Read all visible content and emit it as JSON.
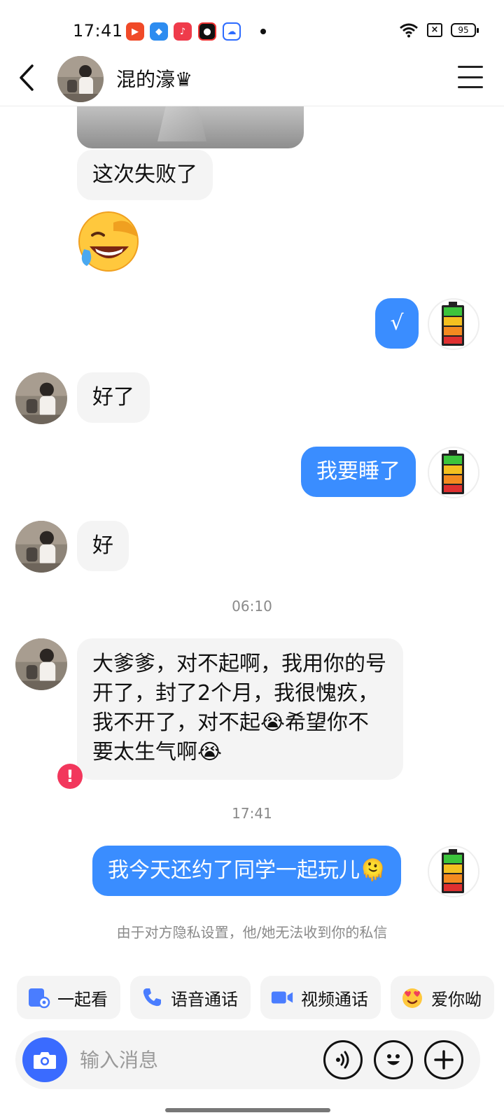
{
  "status_bar": {
    "time": "17:41",
    "battery_level": "95",
    "app_icons": [
      "video-app-icon",
      "blue-app-icon",
      "music-app-icon",
      "record-app-icon",
      "cloud-app-icon"
    ]
  },
  "header": {
    "contact_name": "混的濠♛"
  },
  "messages": [
    {
      "side": "in",
      "text": "这次失败了"
    },
    {
      "side": "out",
      "text": "√"
    },
    {
      "side": "in",
      "text": "好了"
    },
    {
      "side": "out",
      "text": "我要睡了"
    },
    {
      "side": "in",
      "text": "好"
    },
    {
      "side": "in",
      "text": "大爹爹，对不起啊，我用你的号开了，封了2个月，我很愧疚，我不开了，对不起😭希望你不要太生气啊😭"
    },
    {
      "side": "out",
      "text": "我今天还约了同学一起玩儿🫠",
      "failed": true
    }
  ],
  "timestamps": [
    "06:10",
    "17:41"
  ],
  "error_badge": "!",
  "privacy_notice": "由于对方隐私设置，他/她无法收到你的私信",
  "quick_actions": [
    {
      "label": "一起看",
      "icon": "watch-together-icon"
    },
    {
      "label": "语音通话",
      "icon": "phone-icon"
    },
    {
      "label": "视频通话",
      "icon": "video-camera-icon"
    },
    {
      "label": "爱你呦",
      "icon": "heart-eyes-emoji-icon"
    }
  ],
  "input": {
    "placeholder": "输入消息"
  },
  "colors": {
    "outgoing_bubble": "#3a8dff",
    "incoming_bubble": "#f4f4f4",
    "camera_button": "#3a6bff",
    "error_badge": "#f2375c"
  }
}
